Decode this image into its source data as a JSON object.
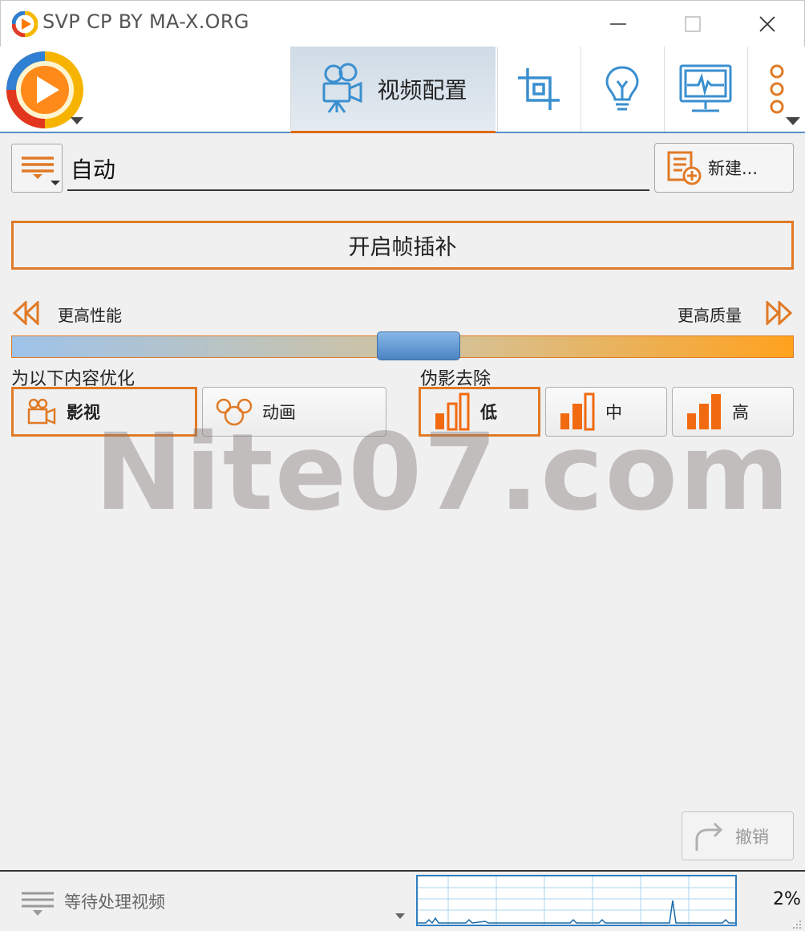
{
  "window": {
    "title": "SVP CP BY MA-X.ORG",
    "icons": {
      "minimize": "minimize-icon",
      "maximize": "maximize-icon",
      "close": "close-icon"
    }
  },
  "toolbar": {
    "tabs": [
      {
        "label": "视频配置",
        "icon": "video-camera-icon",
        "active": true
      },
      {
        "label": "",
        "icon": "crop-icon",
        "active": false
      },
      {
        "label": "",
        "icon": "lightbulb-icon",
        "active": false
      },
      {
        "label": "",
        "icon": "monitor-icon",
        "active": false
      },
      {
        "label": "",
        "icon": "more-icon",
        "active": false
      }
    ]
  },
  "profile": {
    "name": "自动",
    "new_button": "新建..."
  },
  "enable_button": "开启帧插补",
  "slider": {
    "left_label": "更高性能",
    "right_label": "更高质量",
    "value": 0.52
  },
  "optimize": {
    "label": "为以下内容优化",
    "options": [
      {
        "label": "影视",
        "icon": "film-camera-icon",
        "selected": true
      },
      {
        "label": "动画",
        "icon": "mickey-icon",
        "selected": false
      }
    ]
  },
  "artifact": {
    "label": "伪影去除",
    "options": [
      {
        "label": "低",
        "icon": "bars-icon",
        "selected": true
      },
      {
        "label": "中",
        "icon": "bars-icon",
        "selected": false
      },
      {
        "label": "高",
        "icon": "bars-icon",
        "selected": false
      }
    ]
  },
  "watermark": "Nite07.com",
  "undo_button": "撤销",
  "status": {
    "text": "等待处理视频",
    "cpu": "2%"
  },
  "colors": {
    "accent": "#e07a26",
    "tab_underline": "#e06a10",
    "icon_blue": "#3a8fcf",
    "graph_border": "#2f7fc0"
  }
}
